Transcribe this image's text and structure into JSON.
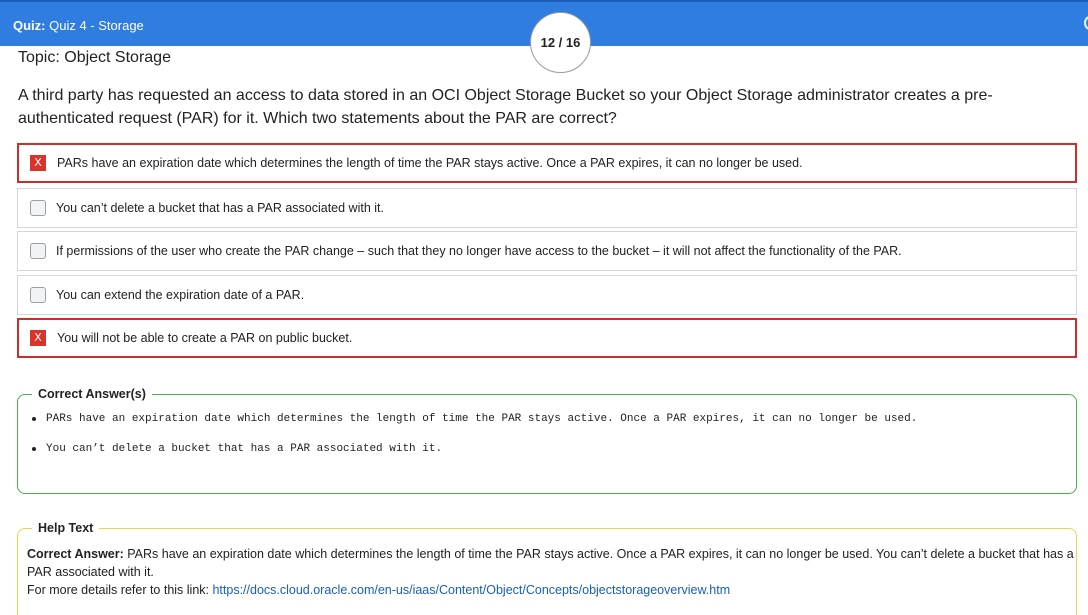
{
  "header": {
    "quiz_label": "Quiz:",
    "quiz_name": "Quiz 4 - Storage",
    "counter": "12 / 16"
  },
  "topic": "Topic: Object Storage",
  "question": "A third party has requested an access to data stored in an OCI Object Storage Bucket so your Object Storage administrator creates a pre-authenticated request (PAR) for it. Which two statements about the PAR are correct?",
  "options": [
    {
      "text": "PARs have an expiration date which determines the length of time the PAR stays active. Once a PAR expires, it can no longer be used.",
      "state": "incorrect-selected",
      "mark": "X"
    },
    {
      "text": "You can’t delete a bucket that has a PAR associated with it.",
      "state": "unchecked"
    },
    {
      "text": "If permissions of the user who create the PAR change – such that they no longer have access to the bucket – it will not affect the functionality of the PAR.",
      "state": "unchecked"
    },
    {
      "text": "You can extend the expiration date of a PAR.",
      "state": "unchecked"
    },
    {
      "text": "You will not be able to create a PAR on public bucket.",
      "state": "incorrect-selected",
      "mark": "X"
    }
  ],
  "correct_answers": {
    "title": "Correct Answer(s)",
    "items": [
      "PARs have an expiration date which determines the length of time the PAR stays active. Once a PAR expires, it can no longer be used.",
      "You can’t delete a bucket that has a PAR associated with it."
    ]
  },
  "help": {
    "title": "Help Text",
    "answer_label": "Correct Answer:",
    "answer_text": " PARs have an expiration date which determines the length of time the PAR stays active. Once a PAR expires, it can no longer be used. You can’t delete a bucket that has a PAR associated with it.",
    "details_label": "For more details refer to this link: ",
    "link": "https://docs.cloud.oracle.com/en-us/iaas/Content/Object/Concepts/objectstorageoverview.htm"
  },
  "colors": {
    "header": "#2f7de1",
    "wrong": "#d9342b",
    "correct_border": "#4caf50",
    "help_border": "#e8d44d",
    "link": "#1a5fb4"
  }
}
